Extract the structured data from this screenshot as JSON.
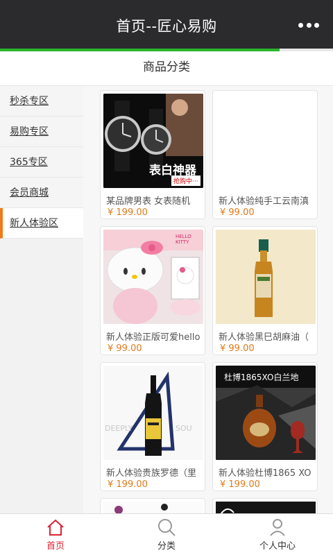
{
  "header": {
    "title": "首页--匠心易购",
    "more_icon": "more-dots-icon",
    "load_progress": 0.84
  },
  "section": {
    "title": "商品分类"
  },
  "sidebar": {
    "items": [
      {
        "label": "秒杀专区"
      },
      {
        "label": "易购专区"
      },
      {
        "label": "365专区"
      },
      {
        "label": "会员商城"
      },
      {
        "label": "新人体验区"
      }
    ],
    "active_index": 4
  },
  "products": [
    {
      "name": "某品牌男表 女表随机",
      "price": "¥ 199.00",
      "img_text": "表白神器",
      "img_sub": "抢购中···"
    },
    {
      "name": "新人体验纯手工云南滇",
      "price": "¥ 99.00"
    },
    {
      "name": "新人体验正版可爱hello",
      "price": "¥ 99.00",
      "img_text": "HELLO KITTY"
    },
    {
      "name": "新人体验黑巳胡麻油（",
      "price": "¥ 99.00"
    },
    {
      "name": "新人体验贵族罗德（里",
      "price": "¥ 199.00"
    },
    {
      "name": "新人体验杜博1865 XO",
      "price": "¥ 199.00",
      "img_text": "杜博1865XO白兰地"
    }
  ],
  "bottom_nav": [
    {
      "label": "首页",
      "icon": "home-icon"
    },
    {
      "label": "分类",
      "icon": "search-icon"
    },
    {
      "label": "个人中心",
      "icon": "user-icon"
    }
  ],
  "colors": {
    "header_bg": "#2b2b2e",
    "progress": "#2ab52a",
    "accent": "#f07a1a",
    "price": "#e07a1a",
    "nav_active": "#dd2233"
  }
}
